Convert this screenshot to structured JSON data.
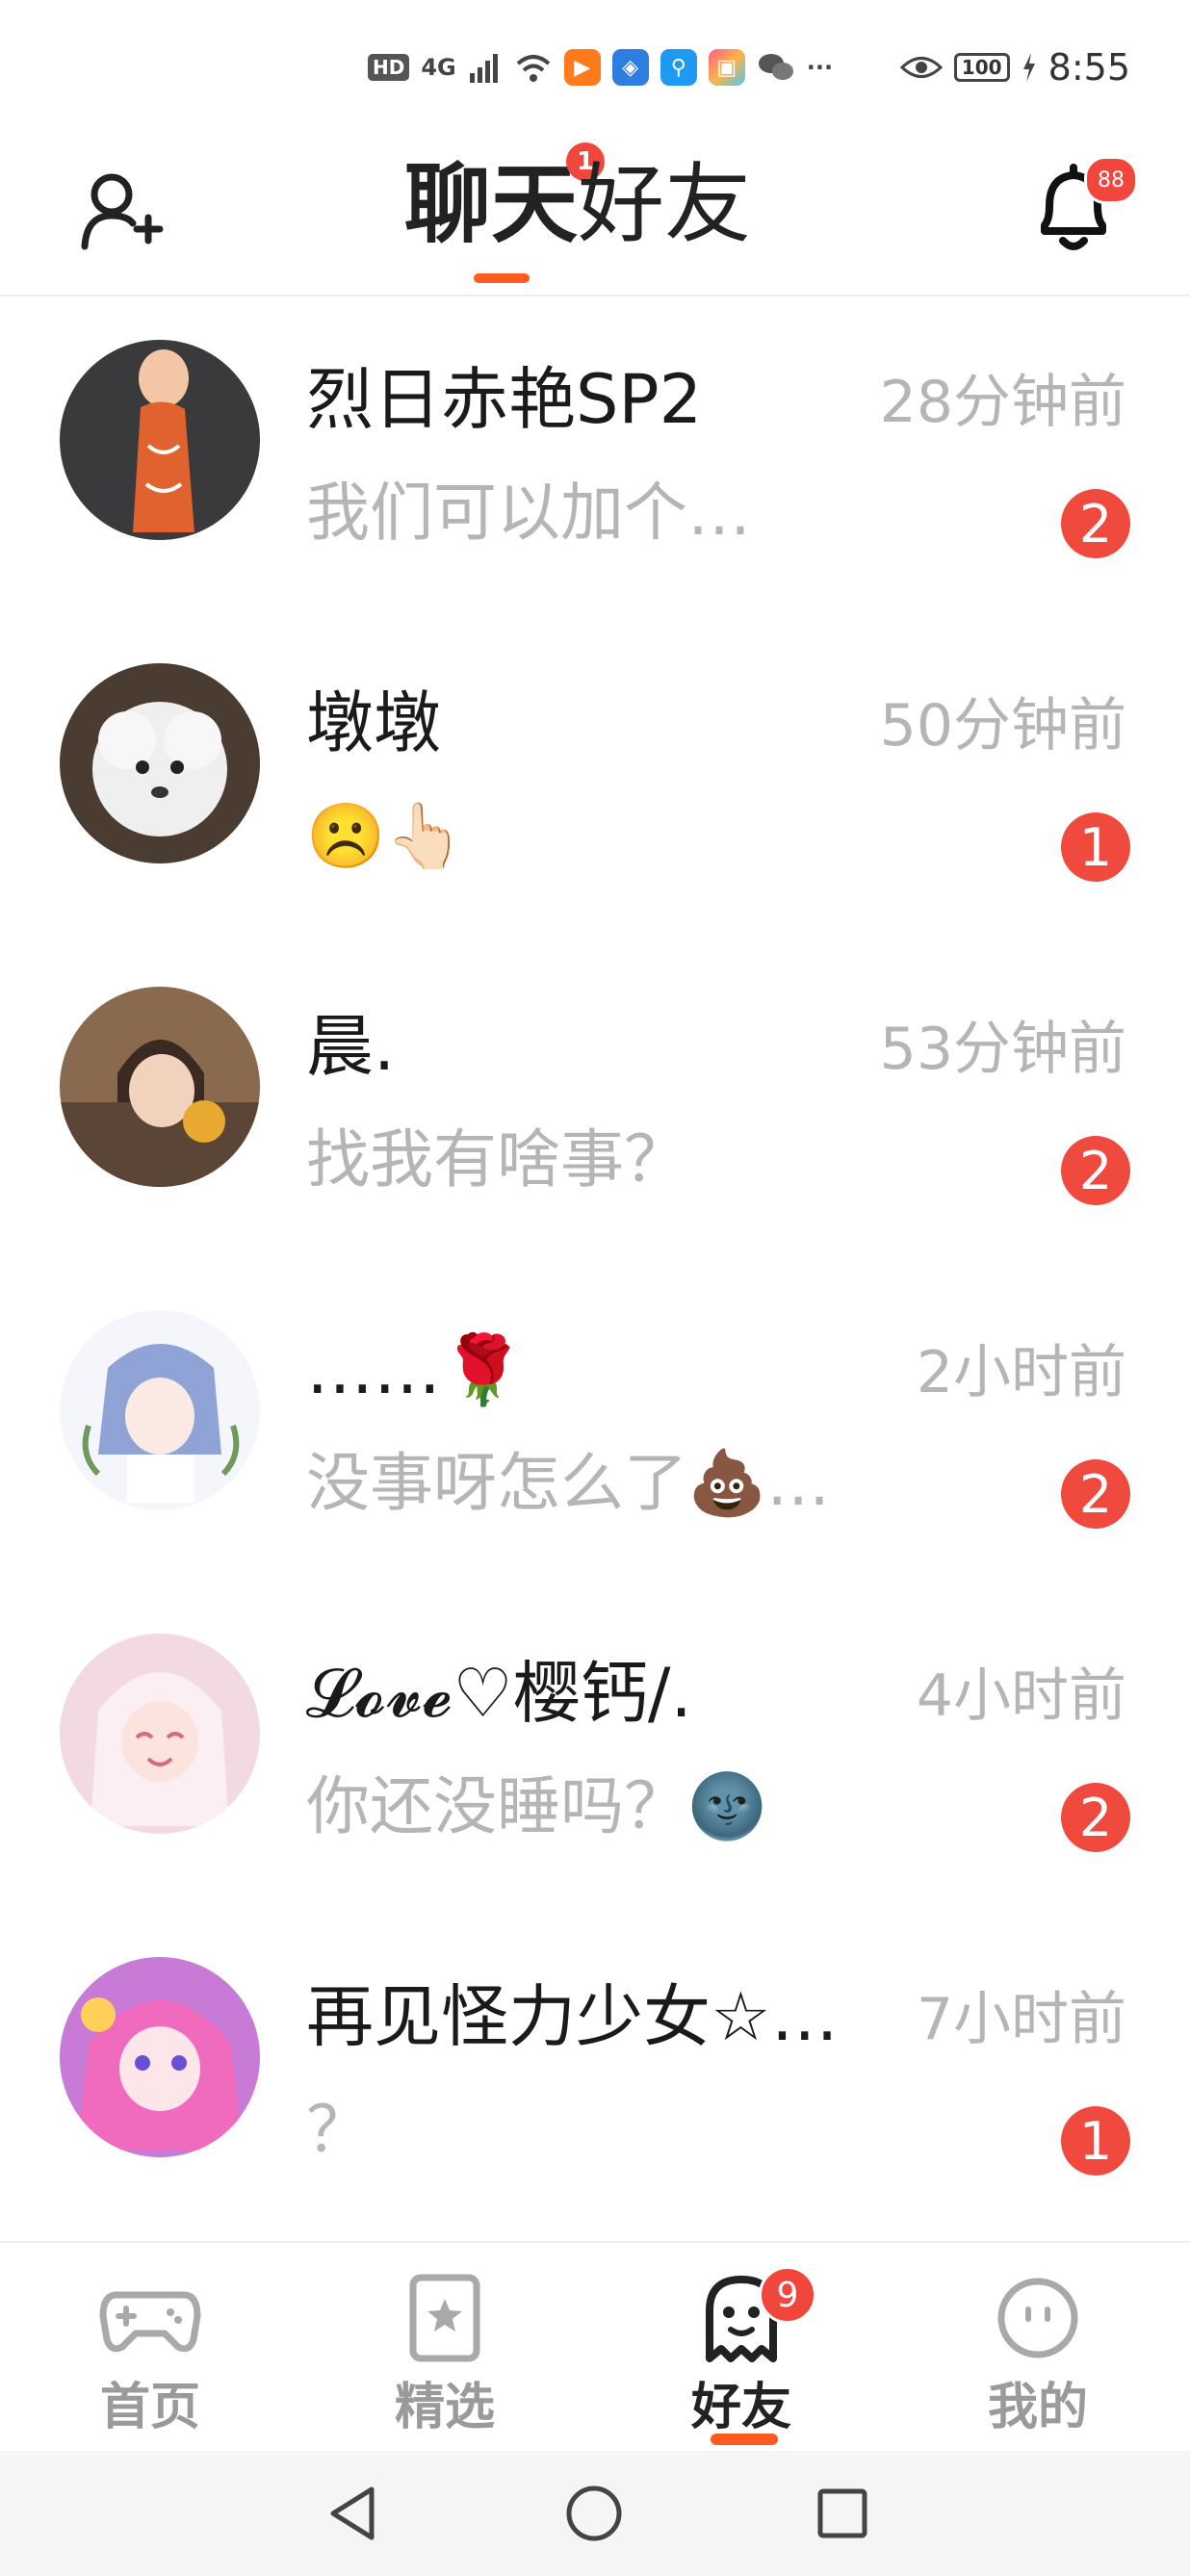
{
  "status_bar": {
    "network": "HD",
    "signal": "4G",
    "more": "···",
    "battery": "100",
    "time": "8:55"
  },
  "header": {
    "tab_chat": "聊天",
    "tab_friends": "好友",
    "chat_tab_badge": "1",
    "notification_count": "88"
  },
  "chats": [
    {
      "name": "烈日赤艳SP2",
      "time": "28分钟前",
      "message": "我们可以加个…",
      "unread": "2"
    },
    {
      "name": "墩墩",
      "time": "50分钟前",
      "message": "☹️👆🏻",
      "unread": "1"
    },
    {
      "name": "晨.",
      "time": "53分钟前",
      "message": "找我有啥事？",
      "unread": "2"
    },
    {
      "name": "……🌹",
      "time": "2小时前",
      "message": "没事呀怎么了💩…",
      "unread": "2"
    },
    {
      "name": "𝓛𝓸𝓿𝓮♡樱钙/.",
      "time": "4小时前",
      "message": "你还没睡吗？🌚",
      "unread": "2"
    },
    {
      "name": "再见怪力少女☆…",
      "time": "7小时前",
      "message": "？",
      "unread": "1"
    }
  ],
  "bottom_nav": {
    "home": "首页",
    "featured": "精选",
    "friends": "好友",
    "friends_badge": "9",
    "mine": "我的"
  },
  "colors": {
    "accent": "#ff5a1f",
    "badge": "#f0463c",
    "secondary_text": "#b5b5b5"
  }
}
